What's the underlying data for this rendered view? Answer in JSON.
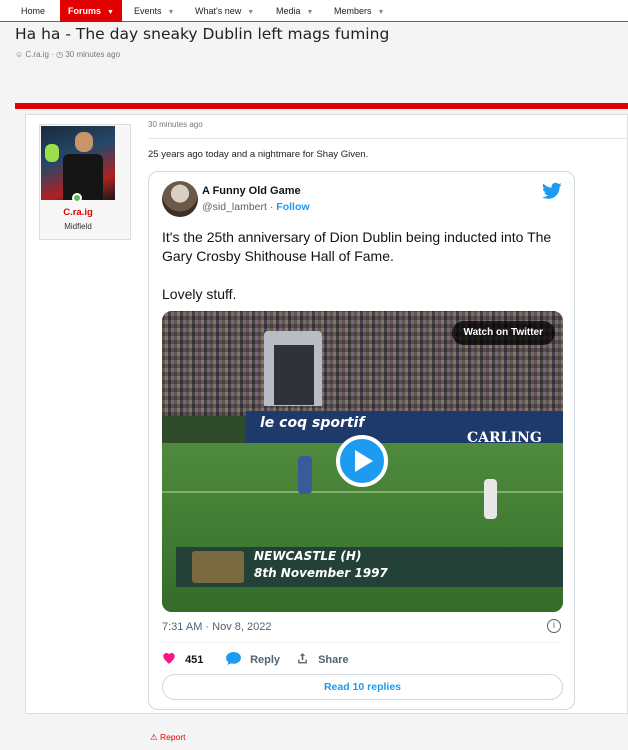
{
  "nav": {
    "items": [
      {
        "label": "Home",
        "dropdown": false
      },
      {
        "label": "Forums",
        "dropdown": true,
        "active": true
      },
      {
        "label": "Events",
        "dropdown": true
      },
      {
        "label": "What's new",
        "dropdown": true
      },
      {
        "label": "Media",
        "dropdown": true
      },
      {
        "label": "Members",
        "dropdown": true
      }
    ]
  },
  "thread": {
    "title": "Ha ha - The day sneaky Dublin left mags fuming",
    "author": "C.ra.ig",
    "time": "30 minutes ago"
  },
  "post": {
    "username": "C.ra.ig",
    "user_title": "Midfield",
    "time": "30 minutes ago",
    "text": "25 years ago today and a nightmare for Shay Given.",
    "report_label": "Report"
  },
  "tweet": {
    "display_name": "A Funny Old Game",
    "handle": "@sid_lambert",
    "follow_label": "Follow",
    "body_line1": "It's the 25th anniversary of Dion Dublin being inducted into The Gary Crosby Shithouse Hall of Fame.",
    "body_line2": "Lovely stuff.",
    "video": {
      "watch_label": "Watch on Twitter",
      "ad_text": "le coq sportif",
      "sponsor": "CARLING",
      "banner_line1": "NEWCASTLE (H)",
      "banner_line2": "8th November 1997"
    },
    "timestamp": "7:31 AM · Nov 8, 2022",
    "likes": "451",
    "reply_label": "Reply",
    "share_label": "Share",
    "read_replies_label": "Read 10 replies"
  },
  "colors": {
    "brand_red": "#e40000",
    "twitter_blue": "#1d9bf0",
    "like_pink": "#f91880"
  }
}
